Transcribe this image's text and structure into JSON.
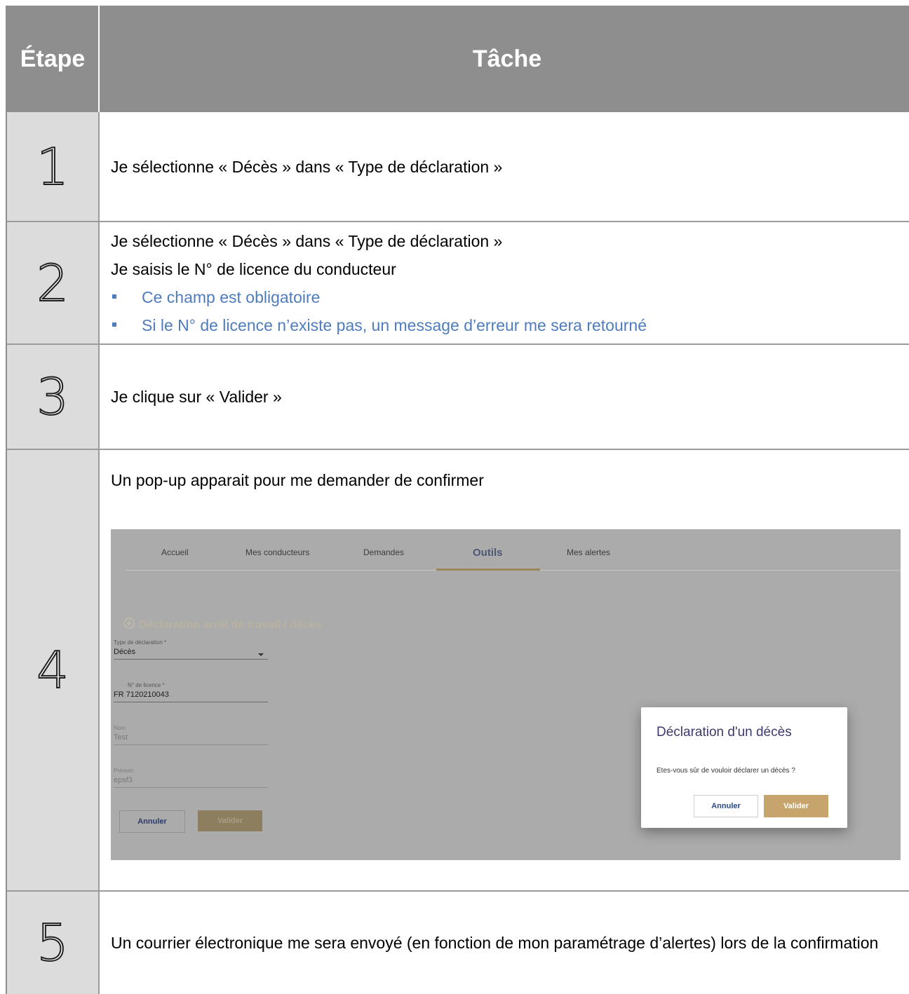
{
  "header": {
    "step": "Étape",
    "task": "Tâche"
  },
  "steps": [
    {
      "number": "1",
      "lines": [
        "Je sélectionne « Décès » dans « Type de déclaration »"
      ]
    },
    {
      "number": "2",
      "lines": [
        "Je sélectionne « Décès » dans « Type de déclaration »",
        "Je saisis le N° de licence du conducteur"
      ],
      "bullets": [
        "Ce champ est obligatoire",
        "Si le N° de licence n’existe pas, un message d’erreur me sera retourné"
      ]
    },
    {
      "number": "3",
      "lines": [
        "Je clique sur « Valider »"
      ]
    },
    {
      "number": "4",
      "lines": [
        "Un pop-up apparait pour me demander de confirmer"
      ]
    },
    {
      "number": "5",
      "lines": [
        "Un courrier électronique me sera envoyé (en fonction de mon paramétrage d’alertes) lors de la confirmation"
      ]
    }
  ],
  "screenshot": {
    "nav": [
      "Accueil",
      "Mes conducteurs",
      "Demandes",
      "Outils",
      "Mes alertes"
    ],
    "active_tab": "Outils",
    "form_title": "Déclaration arrêt de travail / décès",
    "fields": {
      "type": {
        "label": "Type de déclaration *",
        "value": "Décès"
      },
      "licence": {
        "label": "N° de licence *",
        "value": "FR  7120210043"
      },
      "nom": {
        "label": "Nom",
        "value": "Test"
      },
      "prenom": {
        "label": "Prénom",
        "value": "epsf3"
      }
    },
    "buttons": {
      "cancel": "Annuler",
      "validate": "Valider"
    },
    "dialog": {
      "title": "Déclaration d'un décès",
      "message": "Etes-vous sûr de vouloir déclarer un décès ?",
      "cancel": "Annuler",
      "validate": "Valider"
    }
  },
  "colors": {
    "header_bg": "#8e8e8e",
    "step_bg": "#dcdcdc",
    "bullet_text": "#4e7cbd",
    "gold": "#c7a46b"
  }
}
